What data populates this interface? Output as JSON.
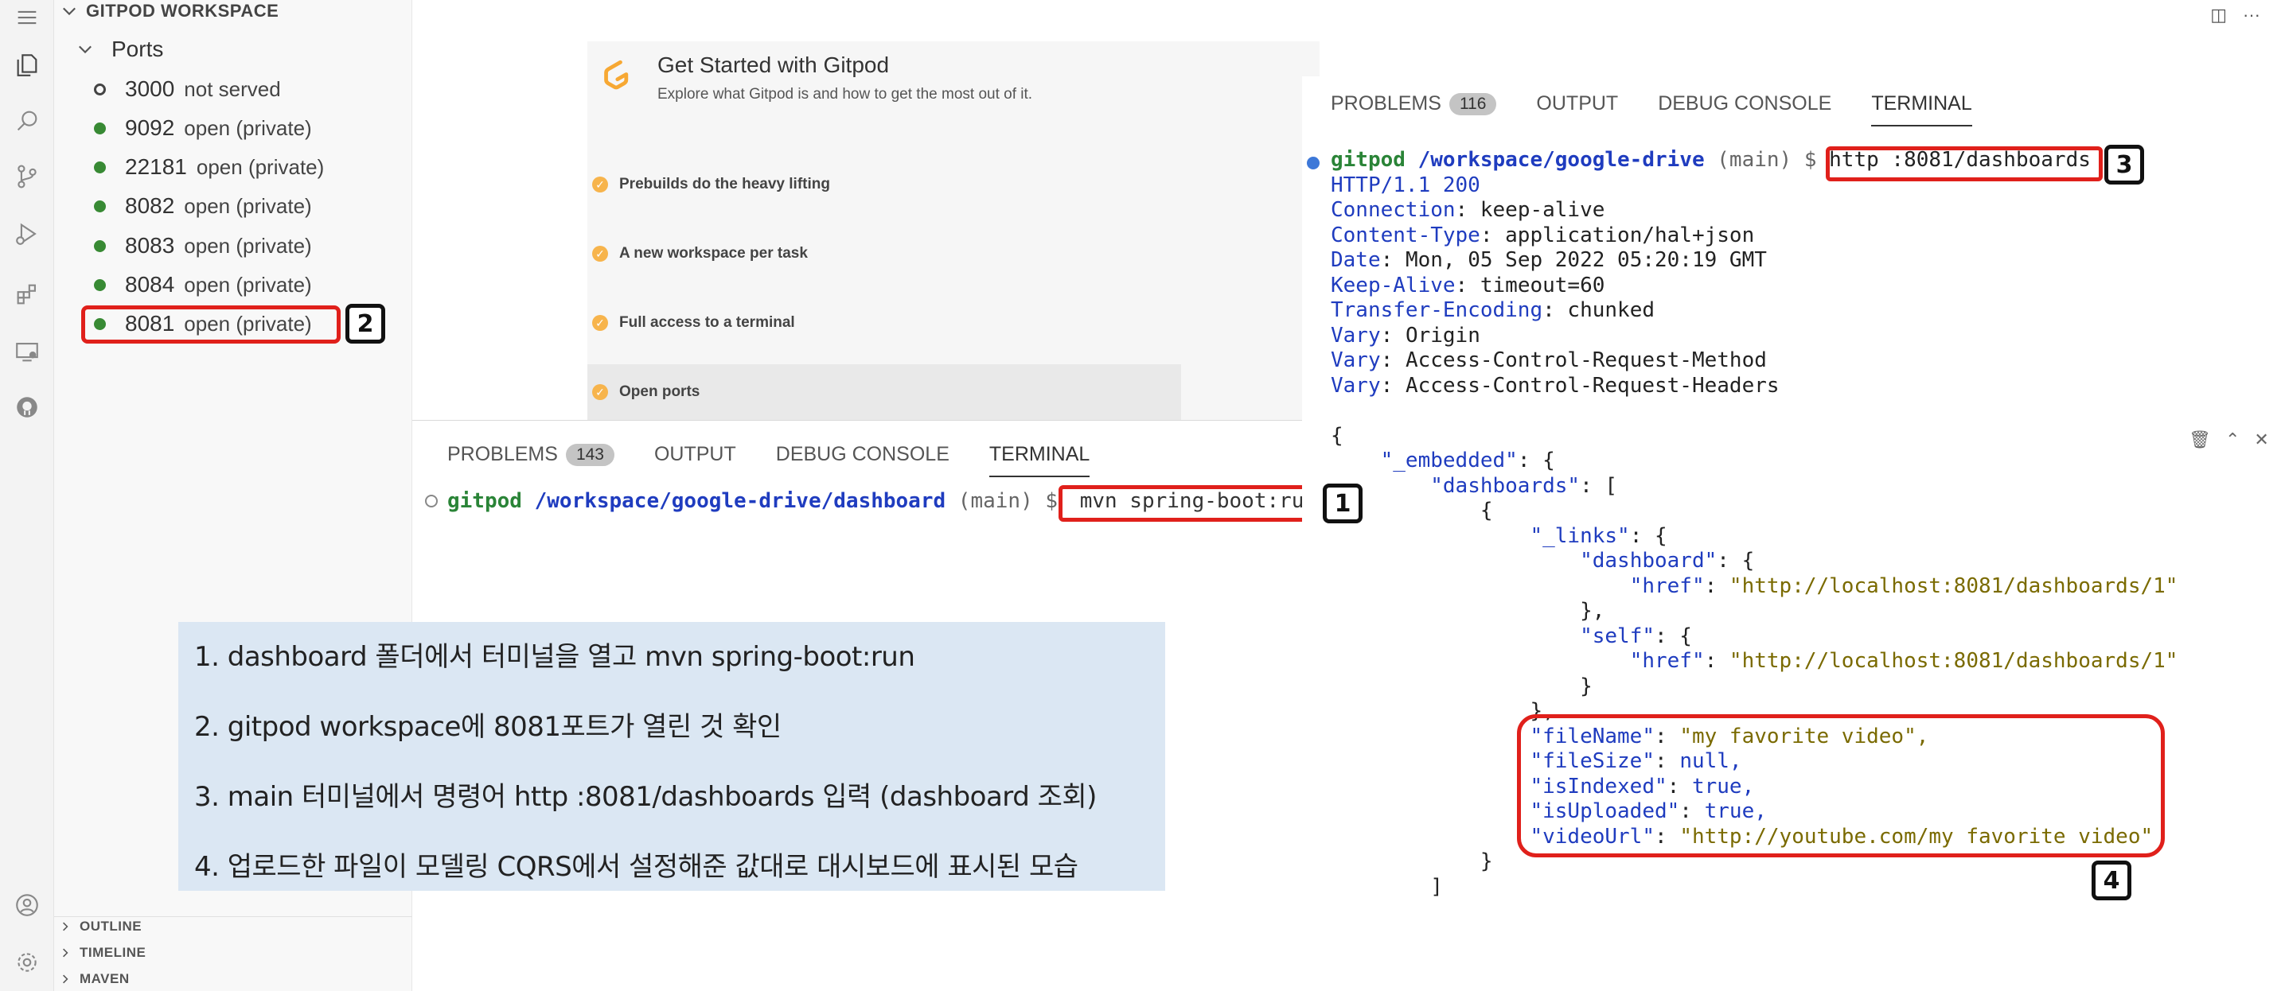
{
  "sidebar": {
    "workspace_title": "GITPOD WORKSPACE",
    "ports_title": "Ports",
    "ports": [
      {
        "port": "3000",
        "status": "not served"
      },
      {
        "port": "9092",
        "status": "open (private)"
      },
      {
        "port": "22181",
        "status": "open (private)"
      },
      {
        "port": "8082",
        "status": "open (private)"
      },
      {
        "port": "8083",
        "status": "open (private)"
      },
      {
        "port": "8084",
        "status": "open (private)"
      },
      {
        "port": "8081",
        "status": "open (private)"
      }
    ],
    "footer_sections": [
      "OUTLINE",
      "TIMELINE",
      "MAVEN"
    ]
  },
  "welcome": {
    "title": "Get Started with Gitpod",
    "subtitle": "Explore what Gitpod is and how to get the most out of it.",
    "items": [
      "Prebuilds do the heavy lifting",
      "A new workspace per task",
      "Full access to a terminal",
      "Open ports"
    ]
  },
  "panel_left": {
    "tabs": [
      {
        "label": "PROBLEMS",
        "badge": "143"
      },
      {
        "label": "OUTPUT"
      },
      {
        "label": "DEBUG CONSOLE"
      },
      {
        "label": "TERMINAL"
      }
    ],
    "prompt_user": "gitpod",
    "prompt_path": "/workspace/google-drive/dashboard",
    "prompt_branch": "(main) $",
    "command": "mvn spring-boot:run"
  },
  "panel_right": {
    "tabs": [
      {
        "label": "PROBLEMS",
        "badge": "116"
      },
      {
        "label": "OUTPUT"
      },
      {
        "label": "DEBUG CONSOLE"
      },
      {
        "label": "TERMINAL"
      }
    ],
    "prompt_user": "gitpod",
    "prompt_path": "/workspace/google-drive",
    "prompt_branch": "(main) $",
    "command": "http :8081/dashboards",
    "status_line": "HTTP/1.1 200",
    "headers": [
      {
        "name": "Connection",
        "value": "keep-alive"
      },
      {
        "name": "Content-Type",
        "value": "application/hal+json"
      },
      {
        "name": "Date",
        "value": "Mon, 05 Sep 2022 05:20:19 GMT"
      },
      {
        "name": "Keep-Alive",
        "value": "timeout=60"
      },
      {
        "name": "Transfer-Encoding",
        "value": "chunked"
      },
      {
        "name": "Vary",
        "value": "Origin"
      },
      {
        "name": "Vary",
        "value": "Access-Control-Request-Method"
      },
      {
        "name": "Vary",
        "value": "Access-Control-Request-Headers"
      }
    ],
    "json": {
      "embedded_key": "\"_embedded\"",
      "dashboards_key": "\"dashboards\"",
      "links_key": "\"_links\"",
      "dashboard_key": "\"dashboard\"",
      "self_key": "\"self\"",
      "href_key": "\"href\"",
      "href_value": "\"http://localhost:8081/dashboards/1\"",
      "fields": [
        {
          "key": "\"fileName\"",
          "value": "\"my favorite video\",",
          "kind": "str"
        },
        {
          "key": "\"fileSize\"",
          "value": "null,",
          "kind": "lit"
        },
        {
          "key": "\"isIndexed\"",
          "value": "true,",
          "kind": "lit"
        },
        {
          "key": "\"isUploaded\"",
          "value": "true,",
          "kind": "lit"
        },
        {
          "key": "\"videoUrl\"",
          "value": "\"http://youtube.com/my favorite video\"",
          "kind": "str"
        }
      ]
    }
  },
  "notes": [
    "1. dashboard 폴더에서 터미널을 열고 mvn spring-boot:run",
    "2. gitpod workspace에 8081포트가 열린 것 확인",
    "3. main 터미널에서 명령어 http :8081/dashboards 입력 (dashboard 조회)",
    "4. 업로드한 파일이 모델링 CQRS에서 설정해준 값대로 대시보드에 표시된 모습"
  ],
  "callouts": [
    "1",
    "2",
    "3",
    "4"
  ],
  "icons": [
    "menu-icon",
    "files-icon",
    "search-icon",
    "source-control-icon",
    "run-debug-icon",
    "extensions-icon",
    "remote-explorer-icon",
    "github-icon",
    "account-icon",
    "settings-gear-icon"
  ],
  "colors": {
    "highlight": "#e0201b",
    "port_open": "#388a34",
    "prompt_green": "#2a8437",
    "path_blue": "#1f3cbf",
    "note_bg": "#dbe7f3",
    "gitpod_orange": "#f7b44c"
  }
}
